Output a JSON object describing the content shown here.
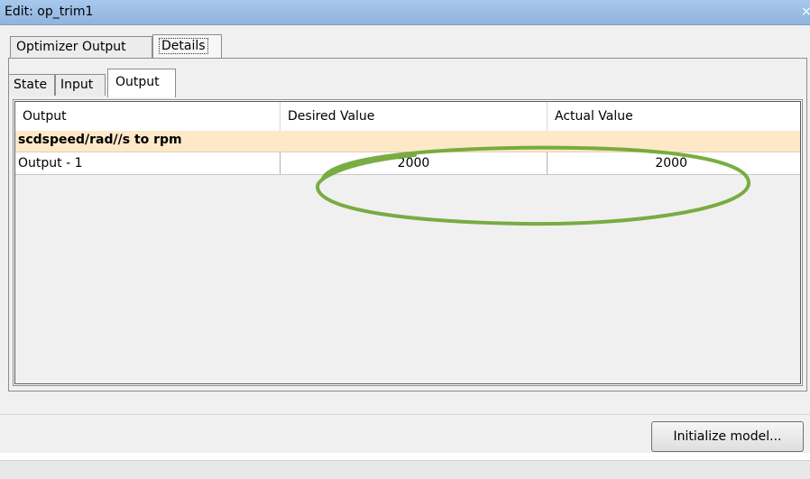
{
  "window": {
    "title": "Edit: op_trim1",
    "close_glyph": "×"
  },
  "outer_tabs": [
    {
      "label": "Optimizer Output",
      "selected": false
    },
    {
      "label": "Details",
      "selected": true
    }
  ],
  "inner_tabs": [
    {
      "label": "State",
      "selected": false
    },
    {
      "label": "Input",
      "selected": false
    },
    {
      "label": "Output",
      "selected": true
    }
  ],
  "table": {
    "columns": [
      "Output",
      "Desired Value",
      "Actual Value"
    ],
    "group_label": "scdspeed/rad//s to rpm",
    "rows": [
      {
        "output": "Output - 1",
        "desired": "2000",
        "actual": "2000"
      }
    ]
  },
  "buttons": {
    "initialize_label": "Initialize model..."
  },
  "colors": {
    "title_bar": "#9dbfe6",
    "group_row": "#fde8c8",
    "highlight": "#6aa42e"
  }
}
